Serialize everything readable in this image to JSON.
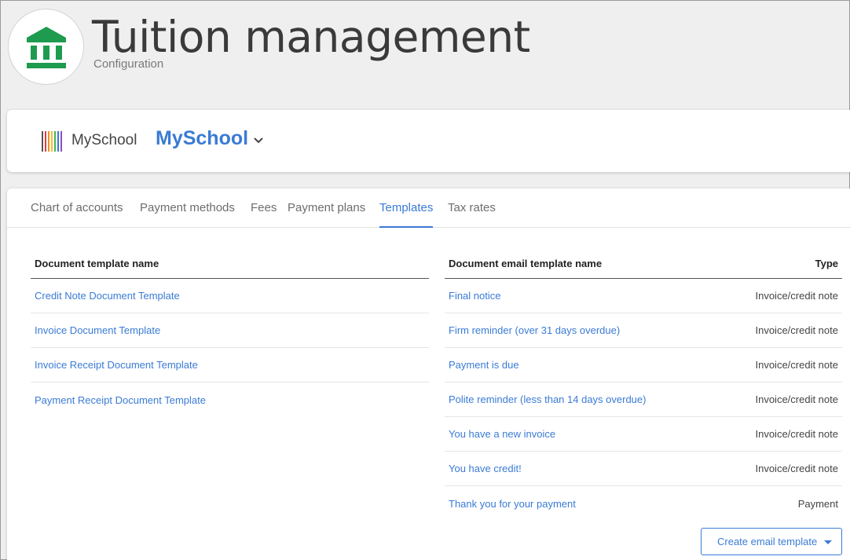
{
  "header": {
    "title": "Tuition management",
    "subtitle": "Configuration",
    "icon": "bank-icon",
    "icon_color": "#1e9b4f"
  },
  "school": {
    "logo_text": "MySchool",
    "name": "MySchool",
    "accent": "#3a7bd5"
  },
  "tabs": [
    {
      "label": "Chart of accounts",
      "active": false
    },
    {
      "label": "Payment methods",
      "active": false
    },
    {
      "label": "Fees",
      "active": false
    },
    {
      "label": "Payment plans",
      "active": false
    },
    {
      "label": "Templates",
      "active": true
    },
    {
      "label": "Tax rates",
      "active": false
    }
  ],
  "document_templates": {
    "header": "Document template name",
    "rows": [
      "Credit Note Document Template",
      "Invoice Document Template",
      "Invoice Receipt Document Template",
      "Payment Receipt Document Template"
    ]
  },
  "email_templates": {
    "header_name": "Document email template name",
    "header_type": "Type",
    "rows": [
      {
        "name": "Final notice",
        "type": "Invoice/credit note"
      },
      {
        "name": "Firm reminder (over 31 days overdue)",
        "type": "Invoice/credit note"
      },
      {
        "name": "Payment is due",
        "type": "Invoice/credit note"
      },
      {
        "name": "Polite reminder (less than 14 days overdue)",
        "type": "Invoice/credit note"
      },
      {
        "name": "You have a new invoice",
        "type": "Invoice/credit note"
      },
      {
        "name": "You have credit!",
        "type": "Invoice/credit note"
      },
      {
        "name": "Thank you for your payment",
        "type": "Payment"
      }
    ],
    "create_button": "Create email template"
  }
}
